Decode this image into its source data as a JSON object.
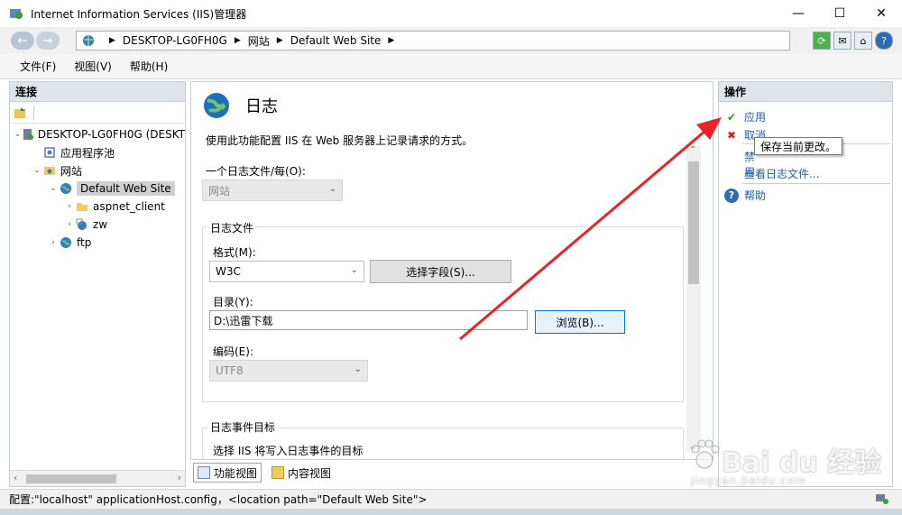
{
  "window": {
    "title": "Internet Information Services (IIS)管理器",
    "controls": [
      "—",
      "☐",
      "✕"
    ]
  },
  "address": {
    "crumbs": [
      "DESKTOP-LG0FH0G",
      "网站",
      "Default Web Site"
    ],
    "separator": "▶"
  },
  "menu": [
    "文件(F)",
    "视图(V)",
    "帮助(H)"
  ],
  "connections": {
    "header": "连接",
    "tree": [
      {
        "label": "DESKTOP-LG0FH0G (DESKT",
        "icon": "server-icon",
        "expander": "⌄"
      },
      {
        "label": "应用程序池",
        "icon": "app-pool-icon",
        "expander": ""
      },
      {
        "label": "网站",
        "icon": "sites-folder-icon",
        "expander": "⌄"
      },
      {
        "label": "Default Web Site",
        "icon": "globe-icon",
        "expander": "⌄"
      },
      {
        "label": "aspnet_client",
        "icon": "folder-icon",
        "expander": "›"
      },
      {
        "label": "zw",
        "icon": "app-icon",
        "expander": "›"
      },
      {
        "label": "ftp",
        "icon": "globe-icon",
        "expander": "›"
      }
    ]
  },
  "main": {
    "title": "日志",
    "description": "使用此功能配置 IIS 在 Web 服务器上记录请求的方式。",
    "per_file_label": "一个日志文件/每(O):",
    "per_file_value": "网站",
    "logfile_group": "日志文件",
    "format_label": "格式(M):",
    "format_value": "W3C",
    "select_fields_button": "选择字段(S)...",
    "directory_label": "目录(Y):",
    "directory_value": "D:\\迅雷下载",
    "browse_button": "浏览(B)...",
    "encoding_label": "编码(E):",
    "encoding_value": "UTF8",
    "event_group": "日志事件目标",
    "event_desc": "选择 IIS 将写入日志事件的目标"
  },
  "view_tabs": [
    "功能视图",
    "内容视图"
  ],
  "actions": {
    "header": "操作",
    "apply": "应用",
    "cancel": "取消",
    "disable": "禁用",
    "view_logs": "查看日志文件...",
    "help": "帮助"
  },
  "tooltip": "保存当前更改。",
  "status": "配置:\"localhost\" applicationHost.config，<location path=\"Default Web Site\">",
  "watermark": {
    "brand": "Bai du 经验",
    "sub": "jingyan.baidu.com"
  },
  "colors": {
    "annotation_arrow": "#e8242a",
    "link": "#1b5fb4"
  }
}
